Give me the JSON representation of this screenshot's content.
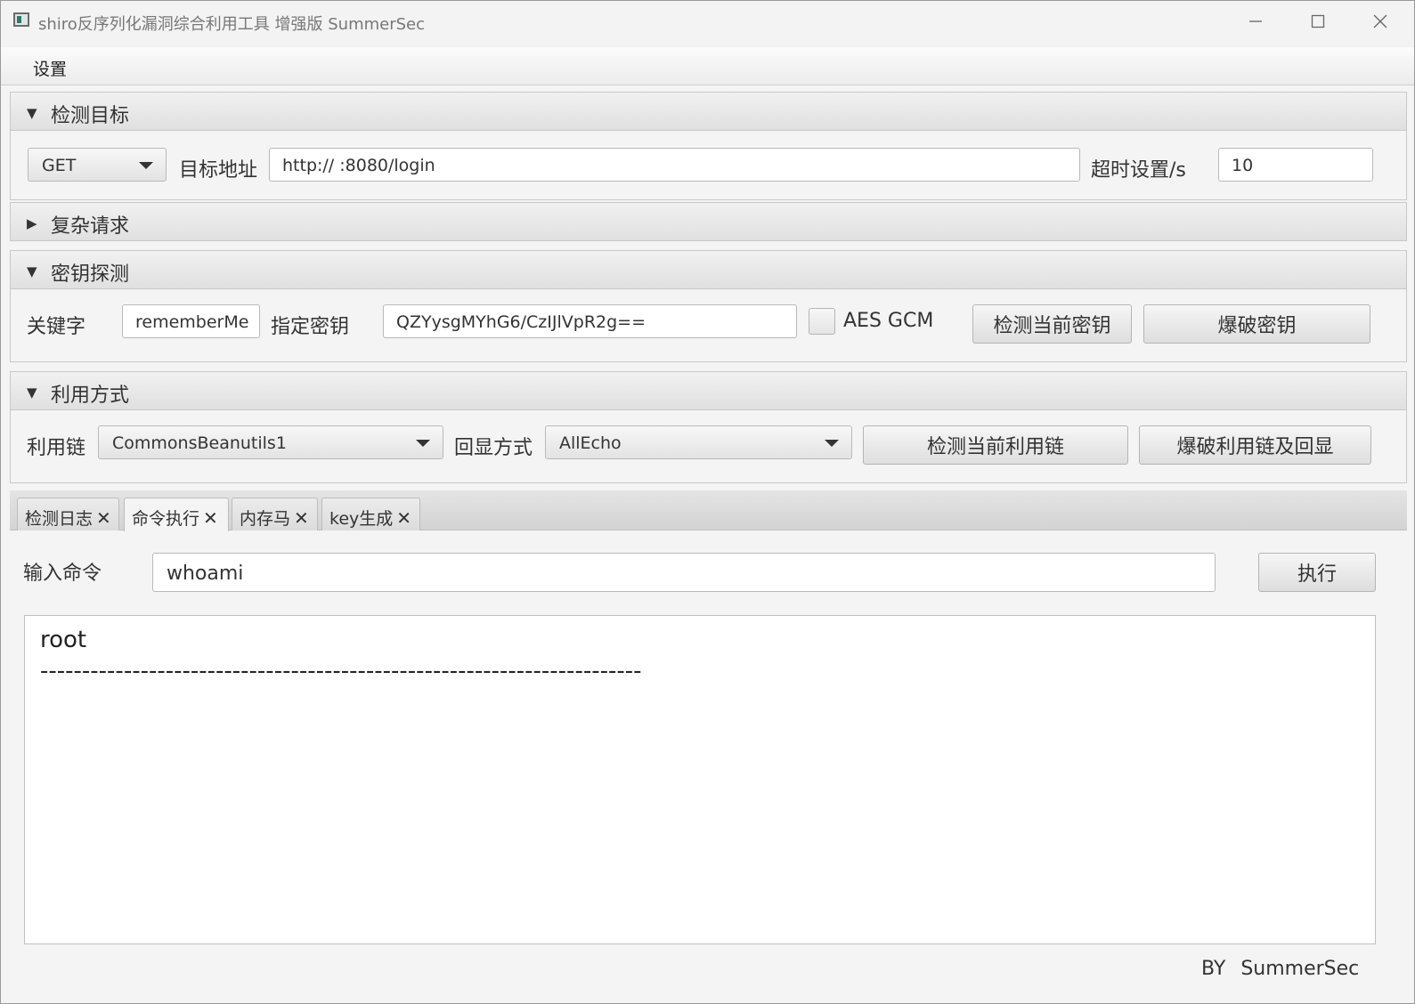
{
  "window": {
    "title": "shiro反序列化漏洞综合利用工具 增强版 SummerSec",
    "icons": [
      "minimize-icon",
      "maximize-icon",
      "close-icon"
    ]
  },
  "menu": {
    "settings": "设置"
  },
  "target_section": {
    "title": "检测目标",
    "method": "GET",
    "url_label": "目标地址",
    "url_value": "http://                    :8080/login",
    "timeout_label": "超时设置/s",
    "timeout_value": "10"
  },
  "complex_section": {
    "title": "复杂请求"
  },
  "key_section": {
    "title": "密钥探测",
    "keyword_label": "关键字",
    "keyword_value": "rememberMe",
    "key_label": "指定密钥",
    "key_value": "QZYysgMYhG6/CzIJlVpR2g==",
    "aes_gcm_label": "AES GCM",
    "aes_gcm_checked": false,
    "detect_key_button": "检测当前密钥",
    "brute_key_button": "爆破密钥"
  },
  "exploit_section": {
    "title": "利用方式",
    "chain_label": "利用链",
    "chain_value": "CommonsBeanutils1",
    "echo_label": "回显方式",
    "echo_value": "AllEcho",
    "detect_chain_button": "检测当前利用链",
    "brute_chain_button": "爆破利用链及回显"
  },
  "tabs": [
    {
      "label": "检测日志",
      "close": "✕"
    },
    {
      "label": "命令执行",
      "close": "✕",
      "active": true
    },
    {
      "label": "内存马",
      "close": "✕"
    },
    {
      "label": "key生成",
      "close": "✕"
    }
  ],
  "command": {
    "label": "输入命令",
    "value": "whoami",
    "execute_button": "执行"
  },
  "output": {
    "line1": "root",
    "line2": "------------------------------------------------------------------------"
  },
  "footer": {
    "text": "BY SummerSec"
  }
}
